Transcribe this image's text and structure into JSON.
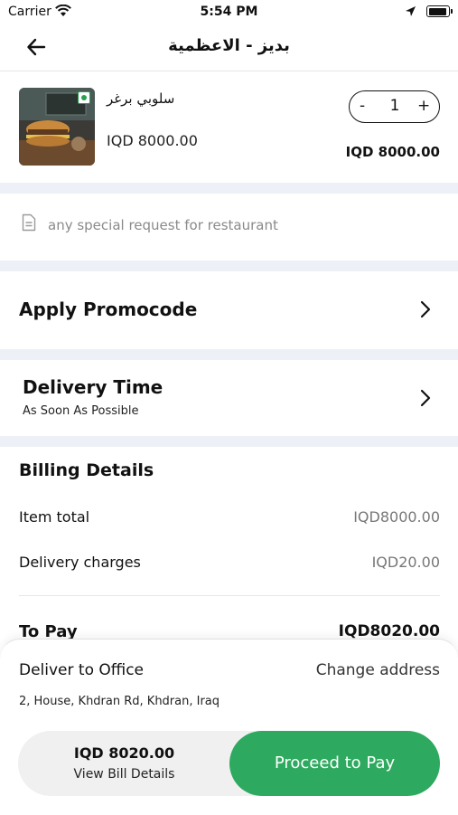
{
  "status_bar": {
    "carrier": "Carrier",
    "time": "5:54 PM"
  },
  "header": {
    "title": "بديز - الاعظمية"
  },
  "cart_item": {
    "name": "سلوبي برغر",
    "unit_price": "IQD 8000.00",
    "quantity": "1",
    "line_total": "IQD 8000.00",
    "minus": "-",
    "plus": "+"
  },
  "special_request": {
    "placeholder": "any special request for restaurant"
  },
  "promo": {
    "label": "Apply Promocode"
  },
  "delivery_time": {
    "label": "Delivery Time",
    "value": "As Soon As Possible"
  },
  "billing": {
    "title": "Billing Details",
    "rows": [
      {
        "label": "Item total",
        "value": "IQD8000.00"
      },
      {
        "label": "Delivery charges",
        "value": "IQD20.00"
      }
    ],
    "to_pay_label": "To Pay",
    "to_pay_value": "IQD8020.00"
  },
  "checkout": {
    "deliver_to": "Deliver to Office",
    "change_address": "Change address",
    "address": "2, House, Khdran Rd, Khdran, Iraq",
    "total": "IQD 8020.00",
    "view_bill": "View Bill Details",
    "pay_button": "Proceed to Pay"
  },
  "colors": {
    "accent_green": "#2daa5f",
    "separator": "#eef0f8",
    "muted_text": "#8a8a8a"
  },
  "icons": [
    "wifi-icon",
    "location-arrow-icon",
    "battery-icon",
    "back-arrow-icon",
    "veg-indicator-icon",
    "document-icon",
    "chevron-right-icon"
  ]
}
